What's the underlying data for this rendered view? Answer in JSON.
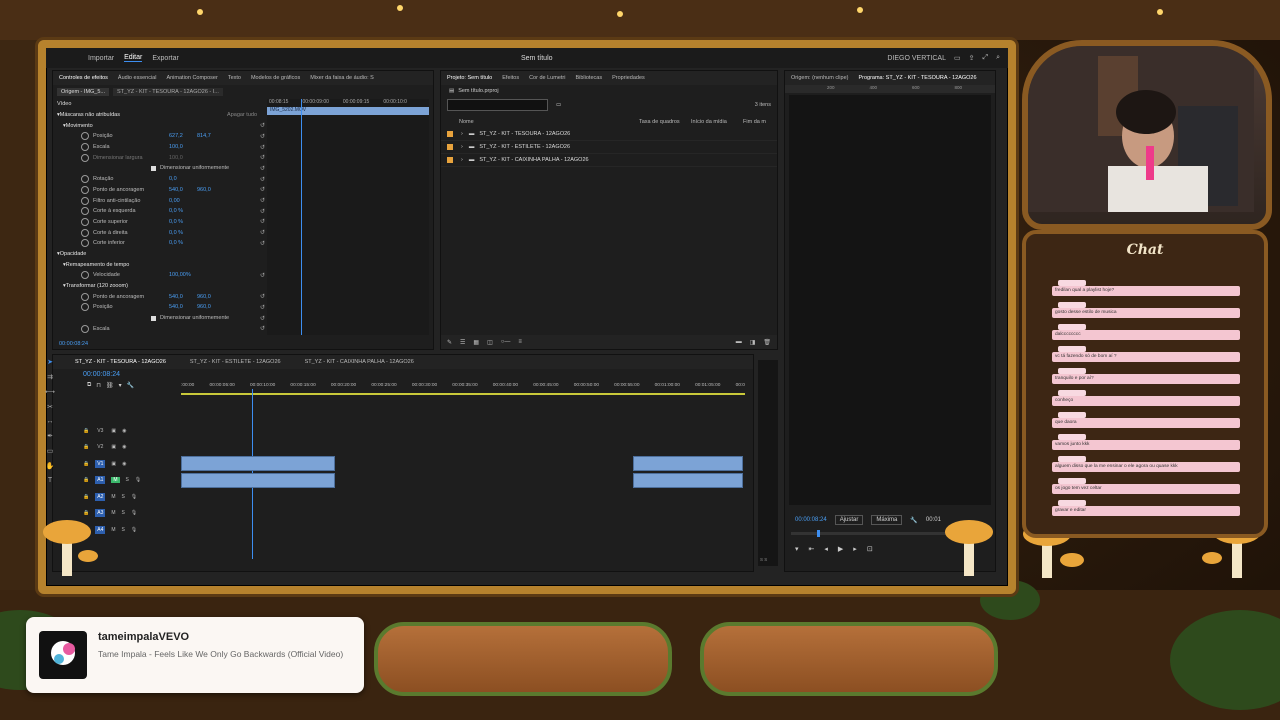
{
  "app": {
    "menu": [
      "Importar",
      "Editar",
      "Exportar"
    ],
    "active_menu": "Editar",
    "title": "Sem título",
    "user": "DIEGO VERTICAL"
  },
  "left_panel": {
    "tabs": [
      "Controles de efeitos",
      "Áudio essencial",
      "Animation Composer",
      "Texto",
      "Modelos de gráficos",
      "Mixer da faixa de áudio: S"
    ],
    "source_tab": "Origem - IMG_5...",
    "sequence_tab": "ST_YZ - KIT - TESOURA - 12AGO26 - I...",
    "section": "Vídeo",
    "clip_name": "IMG_5202.MOV",
    "timecodes": [
      "00:08:15",
      "00:00:09:00",
      "00:00:09:15",
      "00:00:10:0"
    ],
    "rows": [
      {
        "label": "Máscaras não atribuídas",
        "v1": "",
        "v2": "",
        "btn": "Apagar tudo"
      },
      {
        "label": "Movimento",
        "v1": "",
        "v2": ""
      },
      {
        "label": "Posição",
        "v1": "627,2",
        "v2": "814,7"
      },
      {
        "label": "Escala",
        "v1": "100,0",
        "v2": ""
      },
      {
        "label": "Dimensionar largura",
        "v1": "100,0",
        "v2": ""
      },
      {
        "label": "Dimensionar uniformemente",
        "v1": "",
        "v2": ""
      },
      {
        "label": "Rotação",
        "v1": "0,0",
        "v2": ""
      },
      {
        "label": "Ponto de ancoragem",
        "v1": "540,0",
        "v2": "960,0"
      },
      {
        "label": "Filtro anti-cintilação",
        "v1": "0,00",
        "v2": ""
      },
      {
        "label": "Corte à esquerda",
        "v1": "0,0 %",
        "v2": ""
      },
      {
        "label": "Corte superior",
        "v1": "0,0 %",
        "v2": ""
      },
      {
        "label": "Corte à direita",
        "v1": "0,0 %",
        "v2": ""
      },
      {
        "label": "Corte inferior",
        "v1": "0,0 %",
        "v2": ""
      },
      {
        "label": "Opacidade",
        "v1": "",
        "v2": ""
      },
      {
        "label": "Remapeamento de tempo",
        "v1": "",
        "v2": ""
      },
      {
        "label": "Velocidade",
        "v1": "100,00%",
        "v2": ""
      },
      {
        "label": "Transformar (120 zooom)",
        "v1": "",
        "v2": ""
      },
      {
        "label": "Ponto de ancoragem",
        "v1": "540,0",
        "v2": "960,0"
      },
      {
        "label": "Posição",
        "v1": "540,0",
        "v2": "960,0"
      },
      {
        "label": "Dimensionar uniformemente",
        "v1": "",
        "v2": ""
      },
      {
        "label": "Escala",
        "v1": "",
        "v2": ""
      }
    ],
    "footer_time": "00:00:08:24"
  },
  "project_panel": {
    "tabs": [
      "Projeto: Sem título",
      "Efeitos",
      "Cor de Lumetri",
      "Bibliotecas",
      "Propriedades"
    ],
    "file": "Sem título.prproj",
    "search_placeholder": "",
    "count": "3 itens",
    "columns": [
      "Nome",
      "Taxa de quadros",
      "Início da mídia",
      "Fim da m"
    ],
    "items": [
      "ST_YZ - KIT - TESOURA - 12AGO26",
      "ST_YZ - KIT - ESTILETE - 12AGO26",
      "ST_YZ - KIT - CAIXINHA PALHA - 12AGO26"
    ]
  },
  "program_panel": {
    "tabs": [
      "Origem: (nenhum clipe)",
      "Programa: ST_YZ - KIT - TESOURA - 12AGO26"
    ],
    "ruler": [
      "200",
      "400",
      "600",
      "800"
    ],
    "timecode": "00:00:08:24",
    "fit": "Ajustar",
    "quality": "Máxima",
    "end_time": "00:01"
  },
  "timeline": {
    "tabs": [
      "ST_YZ - KIT - TESOURA - 12AGO26",
      "ST_YZ - KIT - ESTILETE - 12AGO26",
      "ST_YZ - KIT - CAIXINHA PALHA - 12AGO26"
    ],
    "timecode": "00:00:08:24",
    "ruler": [
      ":00:00",
      "00:00:05:00",
      "00:00:10:00",
      "00:00:15:00",
      "00:00:20:00",
      "00:00:25:00",
      "00:00:30:00",
      "00:00:35:00",
      "00:00:40:00",
      "00:00:45:00",
      "00:00:50:00",
      "00:00:55:00",
      "00:01:00:00",
      "00:01:05:00",
      "00:0"
    ],
    "video_tracks": [
      "V3",
      "V2",
      "V1"
    ],
    "audio_tracks": [
      "A1",
      "A2",
      "A3",
      "A4"
    ],
    "meter_label": "S S"
  },
  "chat": {
    "title": "Chat",
    "messages": [
      "fredilan qual a playlist hoje?",
      "gosto desse estilo de musica",
      "dalcccccccc",
      "vc tá fazendo só de bom aí ?",
      "tranquilo e por aí?",
      "conheço",
      "que daora",
      "vamos junto kkk",
      "alguem disso que la me ensinar o ele agora ou quase kkk",
      "os jogo tem vez celtar",
      "gravar e editar"
    ]
  },
  "now_playing": {
    "channel": "tameimpalaVEVO",
    "track": "Tame Impala - Feels Like We Only Go Backwards (Official Video)"
  },
  "colors": {
    "frame": "#b6822d",
    "accent": "#3d8ef0",
    "clip": "#7ca3d6",
    "chat_msg": "#f4c6d1",
    "folder": "#e8a33d"
  }
}
